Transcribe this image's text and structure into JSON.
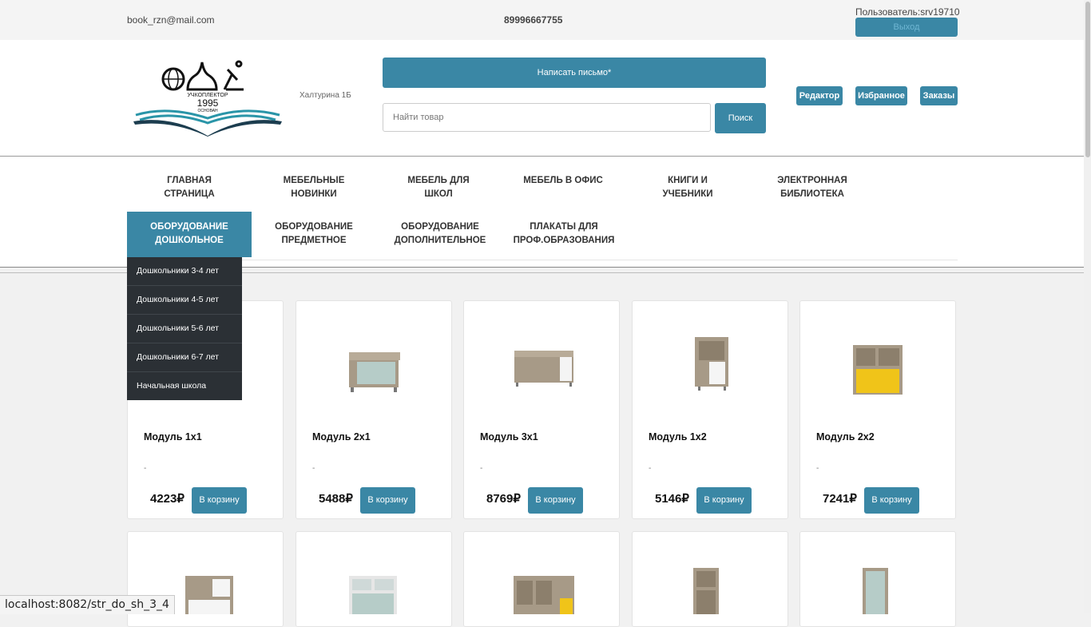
{
  "topbar": {
    "email": "book_rzn@mail.com",
    "phone": "89996667755",
    "user": "Пользователь:srv19710",
    "logout_label": "Выход"
  },
  "header": {
    "logo_text": "УЧКОПЛЕКТОР",
    "logo_year": "1995",
    "logo_founded": "ОСНОВАН",
    "address": "Халтурина 1Б",
    "write_label": "Написать письмо*",
    "search_placeholder": "Найти товар",
    "search_label": "Поиск",
    "nav": {
      "editor": "Редактор",
      "favorites": "Избранное",
      "orders": "Заказы"
    }
  },
  "menu": {
    "row1": [
      {
        "line1": "Главная",
        "line2": "страница"
      },
      {
        "line1": "Мебельные",
        "line2": "новинки"
      },
      {
        "line1": "Мебель для",
        "line2": "школ"
      },
      {
        "line1": "Мебель в офис",
        "line2": ""
      },
      {
        "line1": "Книги и",
        "line2": "учебники"
      },
      {
        "line1": "Электронная",
        "line2": "библиотека"
      }
    ],
    "row2": [
      {
        "line1": "Оборудование",
        "line2": "дошкольное",
        "active": true
      },
      {
        "line1": "Оборудование",
        "line2": "предметное"
      },
      {
        "line1": "Оборудование",
        "line2": "дополнительное"
      },
      {
        "line1": "Плакаты для",
        "line2": "проф.образования"
      }
    ],
    "dropdown": [
      "Дошкольники 3-4 лет",
      "Дошкольники 4-5 лет",
      "Дошкольники 5-6 лет",
      "Дошкольники 6-7 лет",
      "Начальная школа"
    ]
  },
  "products": [
    {
      "title": "Модуль 1х1",
      "desc": "-",
      "price": "4223₽",
      "cart": "В корзину",
      "kind": "none"
    },
    {
      "title": "Модуль 2х1",
      "desc": "-",
      "price": "5488₽",
      "cart": "В корзину",
      "kind": "box"
    },
    {
      "title": "Модуль 3х1",
      "desc": "-",
      "price": "8769₽",
      "cart": "В корзину",
      "kind": "long"
    },
    {
      "title": "Модуль 1х2",
      "desc": "-",
      "price": "5146₽",
      "cart": "В корзину",
      "kind": "tall"
    },
    {
      "title": "Модуль 2х2",
      "desc": "-",
      "price": "7241₽",
      "cart": "В корзину",
      "kind": "yellow"
    }
  ],
  "colors": {
    "accent": "#3a87a5",
    "dropdown_bg": "#2b3035"
  },
  "status_url": "localhost:8082/str_do_sh_3_4"
}
